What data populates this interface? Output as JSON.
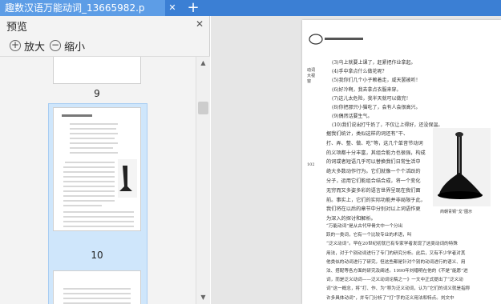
{
  "tab": {
    "title": "趣数汉语万能动词_13665982.p",
    "close": "✕",
    "new_tab": "+"
  },
  "preview_panel": {
    "title": "预览",
    "close": "✕",
    "zoom_in_label": "放大",
    "zoom_out_label": "缩小",
    "pages": [
      {
        "number": "9"
      },
      {
        "number": "10",
        "selected": true
      }
    ]
  },
  "document": {
    "side_label": "动词大视窗",
    "page_number": "102",
    "caption": "商朝青铜“戈”图示",
    "list_items": [
      "(3)乌上就要上课了，赶紧把作业拿起。",
      "(4)手中拿点什么做花呢？",
      "(5)我你们几个小子赖着走，咸天罢被听！",
      "(6)好冷啊，我去拿点衣服来穿。",
      "(7)这儿太危险，我半天就可以做完！",
      "(8)你把那只小猫吃了，会有人会很高兴。",
      "(9)偶然话要生气。",
      "(10)我们说出打牛奶了，不仅让上得好，还没保温。"
    ],
    "paragraph_1": [
      "据我们统计，类似这样的词还有“干、",
      "打、弄、整、做、吃”等，这几个单音节动词",
      "的义项都十分丰富，其组合能力也很强，构成",
      "的词或者短语几乎可以替换我们日常生活中",
      "绝大多数动作行为。它们就像一个个活跃的",
      "分子，运用它们能组合结合成，将一个变化",
      "无穷而又多姿多彩的语言世界呈现在我们面",
      "前。事实上，它们的实际功能并非局限于此，",
      "我们将在以后的章节中分别对以上词语作更",
      "为深入的探讨和解析。"
    ],
    "paragraph_2": [
      "“万能动词”是从古代甲骨文中一个分出",
      "跃的一类词，它有一个比较专业的术语，叫",
      "“泛义动词”。早在20世纪初就已有专家学者发现了这类动词的特殊",
      "用法，对于个别动词进行了专门的研究分析。此后，又有不少学者对其",
      "他类似的动词进行了研究，但这些都是针对个别的动词进行的语义、用",
      "法、搭配等各方面的研究及阐述。1990年刘缙明在他的《不是“能愿”进",
      "词，而是泛义动词——泛义动词论稿之一》一文中正式提出了“泛义动",
      "词”这一概念，将“打、作、为”称为泛义动词，认为“它们的词义就是指称",
      "许多具体动词”，并专门分析了“打”字的泛义用法和特点。刘文中"
    ]
  }
}
